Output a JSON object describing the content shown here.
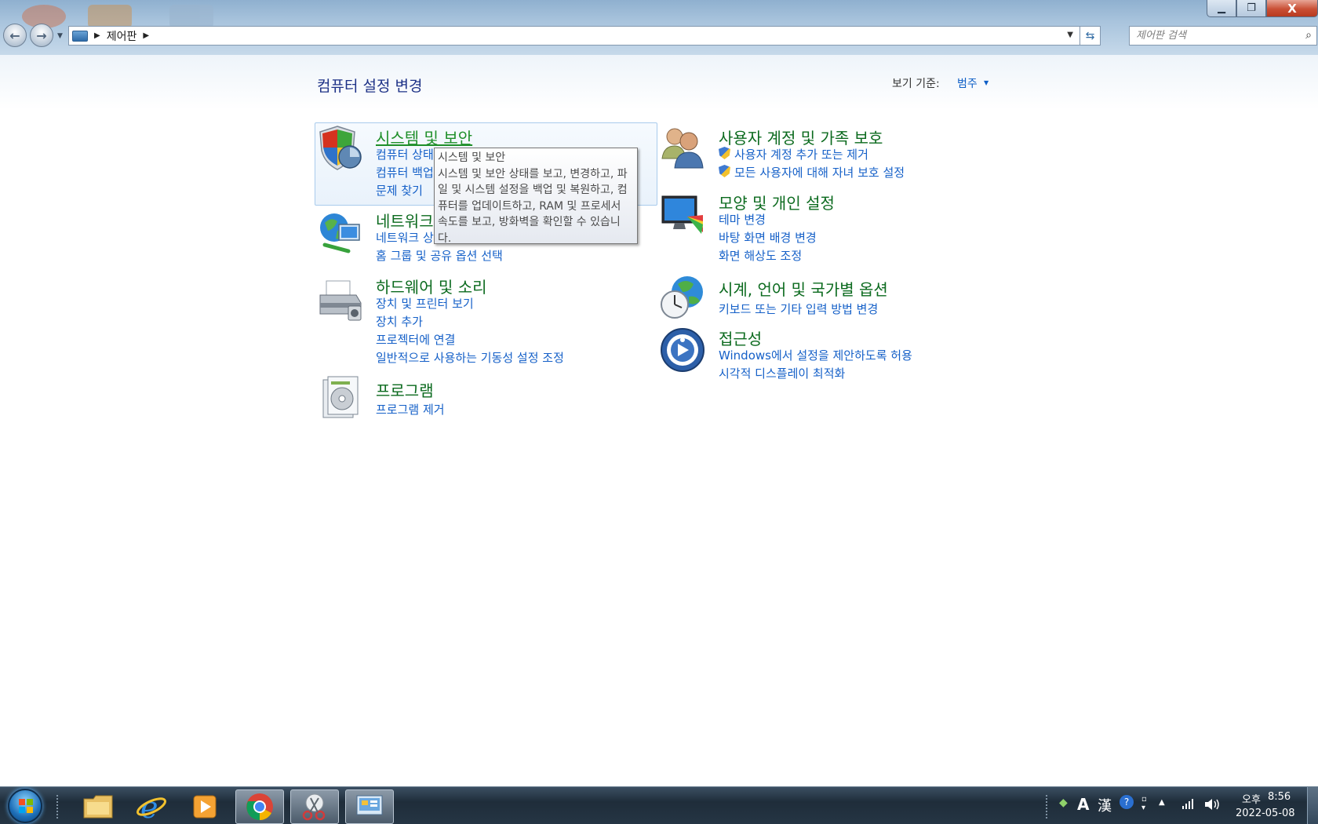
{
  "window": {
    "minimize_label": "▁",
    "restore_label": "❐",
    "close_label": "X"
  },
  "address_bar": {
    "location": "제어판"
  },
  "search": {
    "placeholder": "제어판 검색"
  },
  "page": {
    "title": "컴퓨터 설정 변경",
    "view_by_label": "보기 기준:",
    "view_by_value": "범주"
  },
  "categories": {
    "system_security": {
      "title": "시스템 및 보안",
      "links": [
        "컴퓨터 상태",
        "컴퓨터 백업",
        "문제 찾기"
      ]
    },
    "network": {
      "title": "네트워크",
      "links": [
        "네트워크 상",
        "홈 그룹 및 공유 옵션 선택"
      ]
    },
    "hardware": {
      "title": "하드웨어 및 소리",
      "links": [
        "장치 및 프린터 보기",
        "장치 추가",
        "프로젝터에 연결",
        "일반적으로 사용하는 기동성 설정 조정"
      ]
    },
    "programs": {
      "title": "프로그램",
      "links": [
        "프로그램 제거"
      ]
    },
    "user_accounts": {
      "title": "사용자 계정 및 가족 보호",
      "links": [
        "사용자 계정 추가 또는 제거",
        "모든 사용자에 대해 자녀 보호 설정"
      ]
    },
    "appearance": {
      "title": "모양 및 개인 설정",
      "links": [
        "테마 변경",
        "바탕 화면 배경 변경",
        "화면 해상도 조정"
      ]
    },
    "clock": {
      "title": "시계, 언어 및 국가별 옵션",
      "links": [
        "키보드 또는 기타 입력 방법 변경"
      ]
    },
    "ease": {
      "title": "접근성",
      "links": [
        "Windows에서 설정을 제안하도록 허용",
        "시각적 디스플레이 최적화"
      ]
    }
  },
  "tooltip": {
    "title": "시스템 및 보안",
    "body": "시스템 및 보안 상태를 보고, 변경하고, 파일 및 시스템 설정을 백업 및 복원하고, 컴퓨터를 업데이트하고, RAM 및 프로세서 속도를 보고, 방화벽을 확인할 수 있습니다."
  },
  "taskbar": {
    "apps": [
      "windows-explorer",
      "internet-explorer",
      "media-player",
      "chrome",
      "snipping-tool",
      "control-panel"
    ],
    "ime_mode": "A",
    "ime_hanja": "漢",
    "time_period": "오후",
    "time": "8:56",
    "date": "2022-05-08"
  },
  "colors": {
    "category_title": "#0b6a1e",
    "link": "#1560c8",
    "page_title": "#1e3287"
  }
}
